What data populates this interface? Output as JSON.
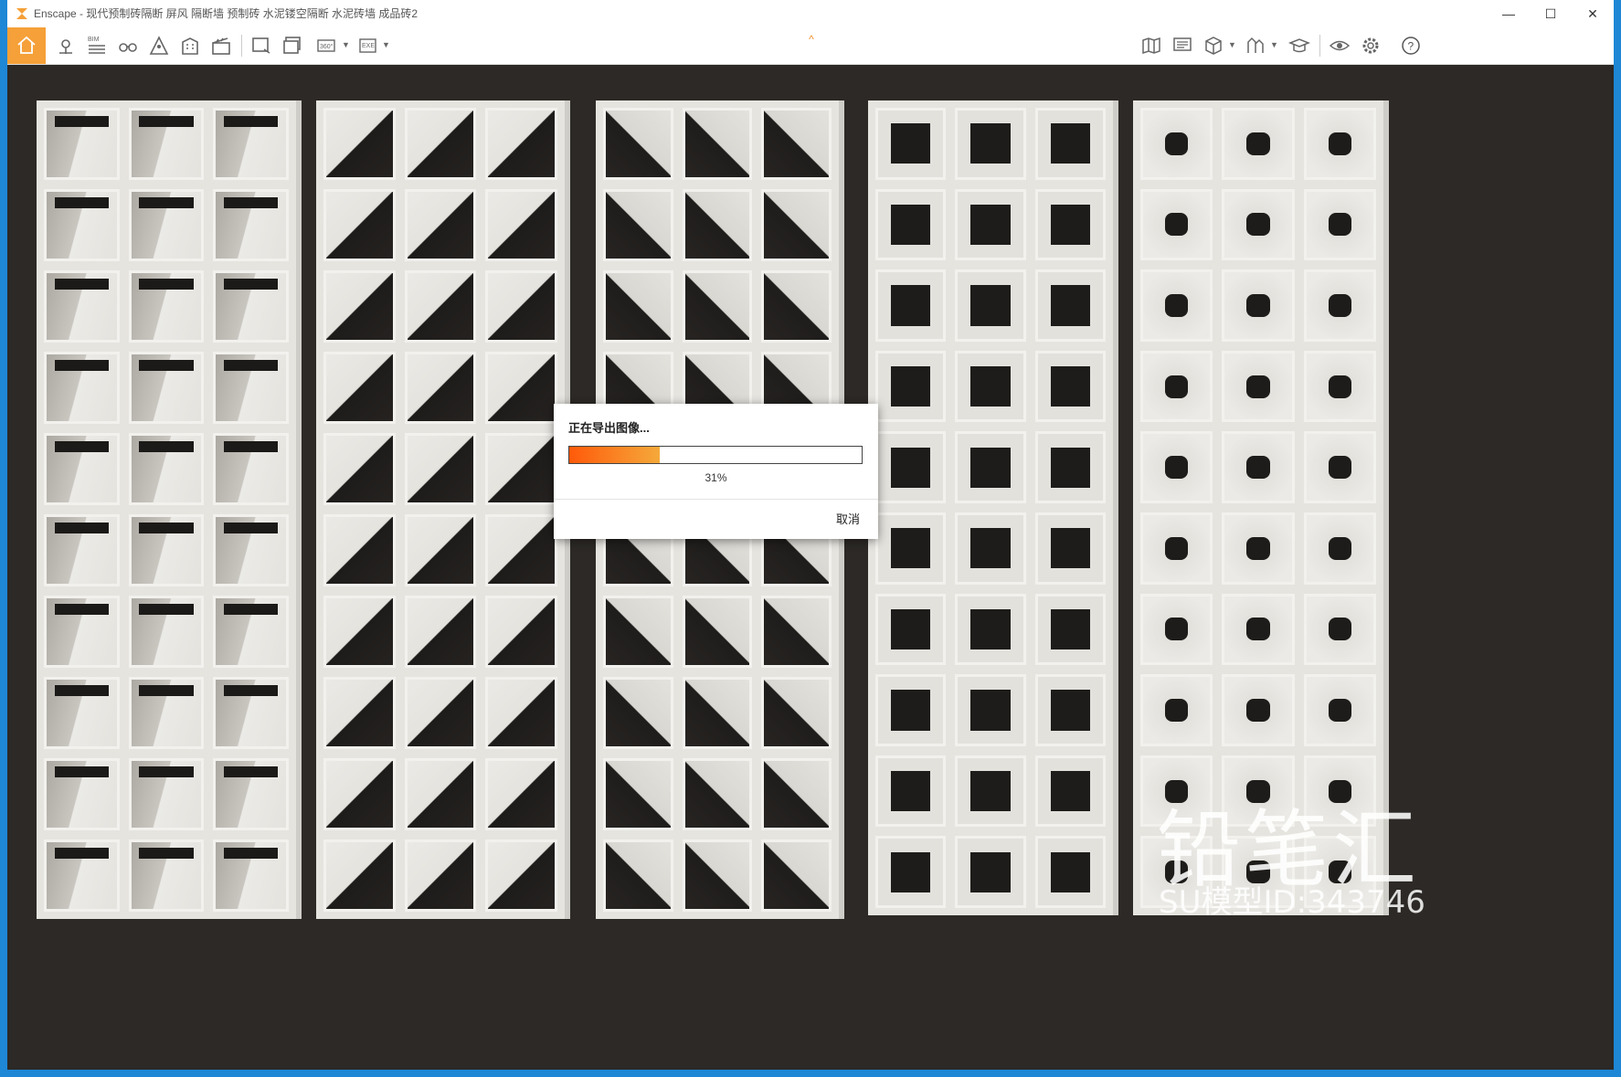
{
  "window": {
    "app_name": "Enscape",
    "title": "Enscape - 现代预制砖隔断 屏风 隔断墙 预制砖 水泥镂空隔断 水泥砖墙 成品砖2",
    "controls": {
      "minimize": "—",
      "maximize": "☐",
      "close": "✕"
    }
  },
  "toolbar": {
    "bim_label": "BIM",
    "pano_label": "360°",
    "exe_label": "EXE",
    "help_label": "?",
    "collapse_glyph": "^",
    "accent_color": "#f5a038"
  },
  "icons": [
    "home-icon",
    "location-pin-icon",
    "bim-list-icon",
    "binoculars-icon",
    "person-view-icon",
    "building-icon",
    "clapperboard-icon",
    "screenshot-icon",
    "batch-render-icon",
    "panorama-360-icon",
    "exe-export-icon",
    "map-icon",
    "presentation-icon",
    "cube-icon",
    "asset-library-icon",
    "graduation-cap-icon",
    "eye-icon",
    "settings-gear-icon",
    "help-icon"
  ],
  "scene": {
    "panels": [
      "p1",
      "p2",
      "p3",
      "p4",
      "p5"
    ],
    "watermark_brand": "铅笔汇",
    "watermark_id": "SU模型ID:343746"
  },
  "export_dialog": {
    "title": "正在导出图像...",
    "progress": 0.31,
    "progress_label": "31%",
    "cancel_label": "取消"
  }
}
